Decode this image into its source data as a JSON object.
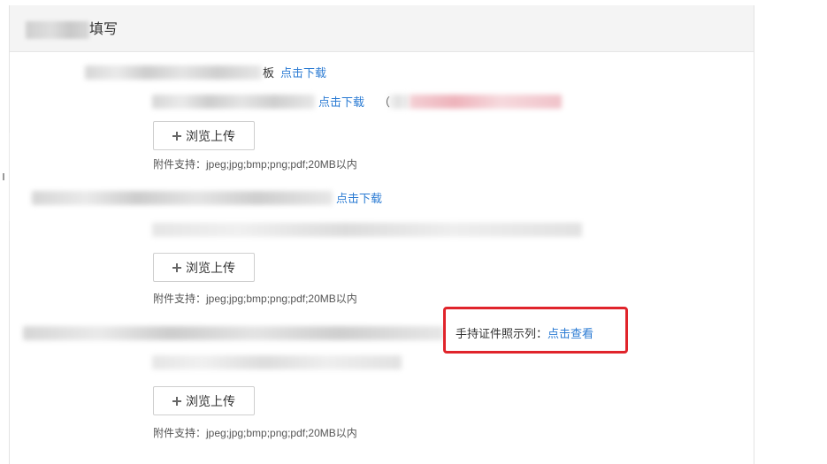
{
  "header": {
    "title_suffix": "填写"
  },
  "section1": {
    "label_tail": "板",
    "download_link": "点击下载",
    "download_link_2": "点击下载",
    "paren": "（",
    "upload_label": "浏览上传",
    "hint": "附件支持：jpeg;jpg;bmp;png;pdf;20MB以内"
  },
  "section2": {
    "download_link": "点击下载",
    "upload_label": "浏览上传",
    "hint": "附件支持：jpeg;jpg;bmp;png;pdf;20MB以内"
  },
  "section3": {
    "example_label": "手持证件照示列：",
    "example_link": "点击查看",
    "upload_label": "浏览上传",
    "hint": "附件支持：jpeg;jpg;bmp;png;pdf;20MB以内"
  },
  "colors": {
    "link": "#2b7bd3",
    "highlight": "#e0242b"
  }
}
